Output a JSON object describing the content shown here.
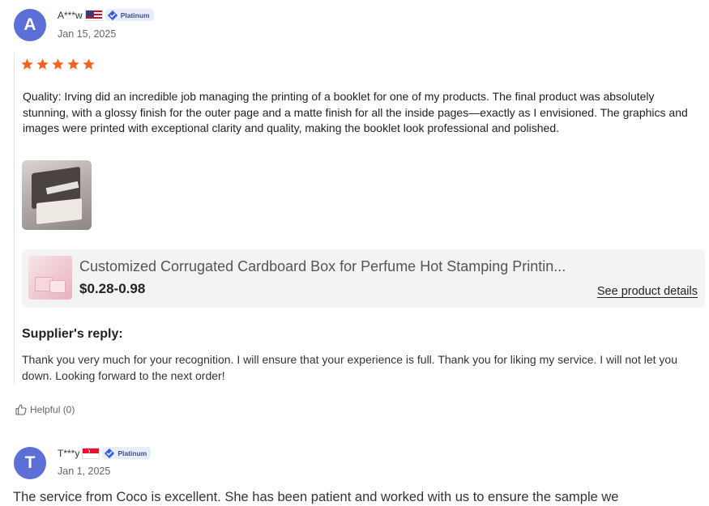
{
  "reviews": [
    {
      "avatar_letter": "A",
      "username": "A***w",
      "country_flag": "us-flag-icon",
      "badge_label": "Platinum",
      "date": "Jan 15, 2025",
      "rating": 5,
      "text": "Quality: Irving did an incredible job managing the printing of a booklet for one of my products. The final product was absolutely stunning, with a glossy finish for the outer page and a matte finish for all the inside pages—exactly as I envisioned. The graphics and images were printed with exceptional clarity and quality, making the booklet look professional and polished.",
      "product": {
        "title": "Customized Corrugated Cardboard Box for Perfume Hot Stamping Printin...",
        "price": "$0.28-0.98",
        "details_link": "See product details"
      },
      "supplier_reply_heading": "Supplier's reply:",
      "supplier_reply": "Thank you very much for your recognition. I will ensure that your experience is full. Thank you for liking my service. I will not let you down. Looking forward to the next order!",
      "helpful_label": "Helpful (0)"
    },
    {
      "avatar_letter": "T",
      "username": "T***y",
      "country_flag": "sg-flag-icon",
      "badge_label": "Platinum",
      "date": "Jan 1, 2025",
      "text": "The service from Coco is excellent. She has been patient and worked with us to ensure the sample we"
    }
  ],
  "colors": {
    "avatar": "#5b6fd6",
    "star": "#f5641e",
    "badge_bg": "#e8edf9",
    "badge_icon": "#3b5bdb",
    "card_bg": "#f3f3f3"
  }
}
